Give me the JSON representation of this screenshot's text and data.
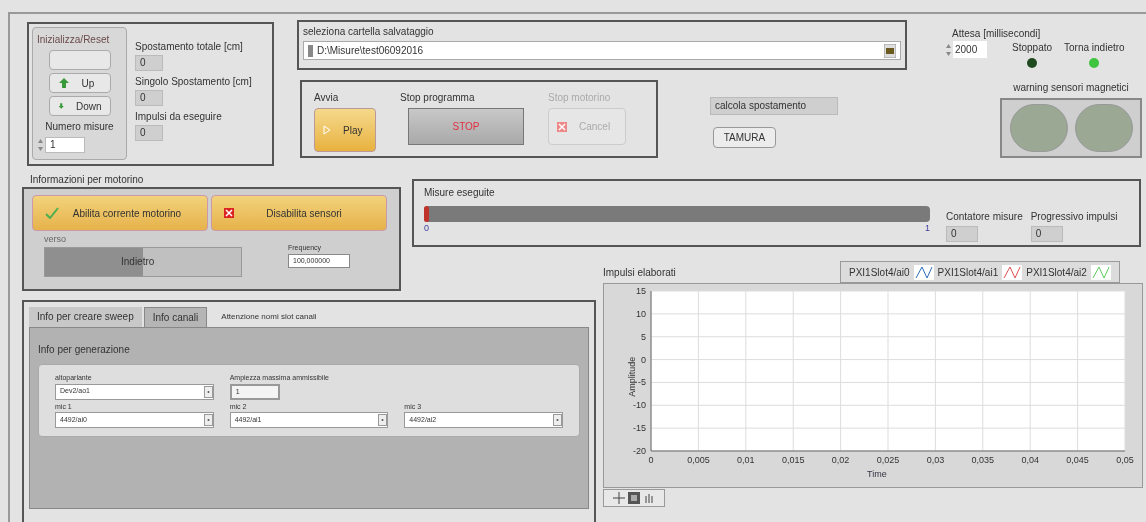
{
  "init_cluster": {
    "label": "Inizializza/Reset",
    "buttons": [
      {
        "kind": "blank"
      },
      {
        "kind": "up",
        "label": "Up"
      },
      {
        "kind": "down",
        "label": "Down"
      }
    ],
    "count": {
      "label": "Numero misure",
      "value": "1"
    }
  },
  "indicators": [
    {
      "label": "Spostamento totale [cm]",
      "value": "0"
    },
    {
      "label": "Singolo Spostamento [cm]",
      "value": "0"
    },
    {
      "label": "Impulsi da eseguire",
      "value": "0"
    }
  ],
  "path": {
    "label": "seleziona cartella salvataggio",
    "value": "D:\\Misure\\test06092016"
  },
  "run_group": [
    {
      "label": "Avvia",
      "button": "Play",
      "kind": "play",
      "disabled": false
    },
    {
      "label": "Stop programma",
      "button": "STOP",
      "kind": "stop",
      "disabled": false
    },
    {
      "label": "Stop motorino",
      "button": "Cancel",
      "kind": "cancel",
      "disabled": true
    }
  ],
  "calcola": {
    "value": "calcola spostamento",
    "button": "TAMURA"
  },
  "attesa": {
    "label": "Attesa [millisecondi]",
    "value": "2000"
  },
  "leds": [
    {
      "label": "Stoppato",
      "on": false
    },
    {
      "label": "Torna indietro",
      "on": true
    }
  ],
  "warning": {
    "label": "warning sensori magnetici",
    "lights": [
      {
        "on": false
      },
      {
        "on": false
      }
    ]
  },
  "motor": {
    "title": "Informazioni per motorino",
    "buttons": [
      {
        "label": "Abilita corrente motorino",
        "kind": "check"
      },
      {
        "label": "Disabilita sensori",
        "kind": "cross"
      }
    ],
    "verso": {
      "label": "verso",
      "value": "Indietro",
      "level": 0.5
    },
    "frequency": {
      "label": "Frequency",
      "value": "100,000000"
    }
  },
  "progress": {
    "label": "Misure eseguite",
    "level": 0.01,
    "min": "0",
    "max": "1"
  },
  "counters": [
    {
      "label": "Contatore misure",
      "value": "0"
    },
    {
      "label": "Progressivo impulsi",
      "value": "0"
    }
  ],
  "tabs": [
    {
      "label": "Info per creare sweep",
      "selected": false
    },
    {
      "label": "Info canali",
      "selected": true
    }
  ],
  "tab_note": "Attenzione nomi slot canali",
  "tab_content": {
    "title": "Info per generazione",
    "rows": [
      [
        {
          "label": "altoparlante",
          "value": "Dev2/ao1",
          "kind": "ring"
        },
        {
          "label": "Ampiezza massima ammissibile",
          "value": "1",
          "kind": "numeric"
        }
      ],
      [
        {
          "label": "mic 1",
          "value": "4492/ai0",
          "kind": "ring"
        },
        {
          "label": "mic 2",
          "value": "4492/ai1",
          "kind": "ring"
        },
        {
          "label": "mic 3",
          "value": "4492/ai2",
          "kind": "ring"
        }
      ]
    ]
  },
  "chart": {
    "chart_data": {
      "type": "line",
      "title": "Impulsi elaborati",
      "xlabel": "Time",
      "ylabel": "Amplitude",
      "grid": true,
      "ylim": [
        -20,
        15
      ],
      "categories": [
        "0",
        "0,005",
        "0,01",
        "0,015",
        "0,02",
        "0,025",
        "0,03",
        "0,035",
        "0,04",
        "0,045",
        "0,05"
      ],
      "yticks": [
        15,
        10,
        5,
        0,
        -5,
        -10,
        -15,
        -20
      ],
      "series": [
        {
          "name": "PXI1Slot4/ai0",
          "color": "#2a6ebb",
          "values": [
            null,
            null,
            null,
            null,
            null,
            null,
            null,
            null,
            null,
            null,
            null
          ]
        },
        {
          "name": "PXI1Slot4/ai1",
          "color": "#e05050",
          "values": [
            null,
            null,
            null,
            null,
            null,
            null,
            null,
            null,
            null,
            null,
            null
          ]
        },
        {
          "name": "PXI1Slot4/ai2",
          "color": "#5ccc5c",
          "values": [
            null,
            null,
            null,
            null,
            null,
            null,
            null,
            null,
            null,
            null,
            null
          ]
        }
      ]
    }
  }
}
